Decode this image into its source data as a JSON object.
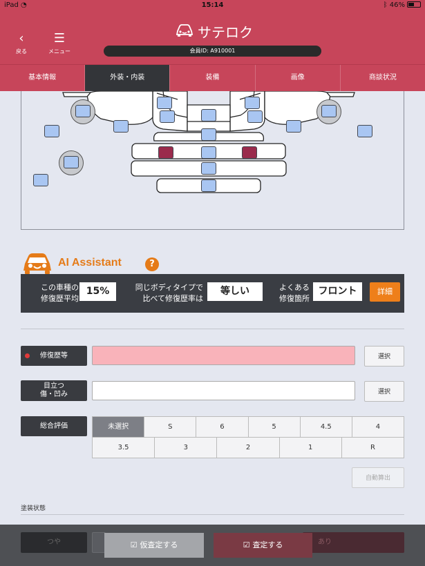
{
  "status_bar": {
    "device": "iPad",
    "time": "15:14",
    "battery": "46%"
  },
  "header": {
    "back_label": "戻る",
    "menu_label": "メニュー",
    "app_title": "サテロク",
    "member_id": "会員ID: A910001",
    "brand_color": "#c7455a"
  },
  "tabs": [
    {
      "label": "基本情報",
      "active": false
    },
    {
      "label": "外装・内装",
      "active": true
    },
    {
      "label": "装備",
      "active": false
    },
    {
      "label": "画像",
      "active": false
    },
    {
      "label": "商談状況",
      "active": false
    }
  ],
  "diagram": {
    "selected_color": "#9a2b4c",
    "panel_color": "#a9c6f2"
  },
  "ai": {
    "title": "AI Assistant",
    "help": "?",
    "avg_label_1": "この車種の",
    "avg_label_2": "修復歴平均",
    "avg_value": "15%",
    "body_label_1": "同じボディタイプで",
    "body_label_2": "比べて修復歴率は",
    "body_value": "等しい",
    "common_label_1": "よくある",
    "common_label_2": "修復箇所",
    "common_value": "フロント",
    "detail_button": "詳細",
    "accent_color": "#e57b18"
  },
  "form": {
    "repair_label": "修復歴等",
    "repair_select": "選択",
    "damage_label_1": "目立つ",
    "damage_label_2": "傷・凹み",
    "damage_select": "選択",
    "grade_label": "総合評価",
    "grade_row1": [
      "未選択",
      "S",
      "6",
      "5",
      "4.5",
      "4"
    ],
    "grade_row2": [
      "3.5",
      "3",
      "2",
      "1",
      "R"
    ],
    "grade_selected": "未選択",
    "auto_calc": "自動算出",
    "paint_section": "塗装状態"
  },
  "bottom": {
    "gloss_label": "つや",
    "ari_label": "あり",
    "temp_assess": "仮査定する",
    "assess": "査定する"
  }
}
